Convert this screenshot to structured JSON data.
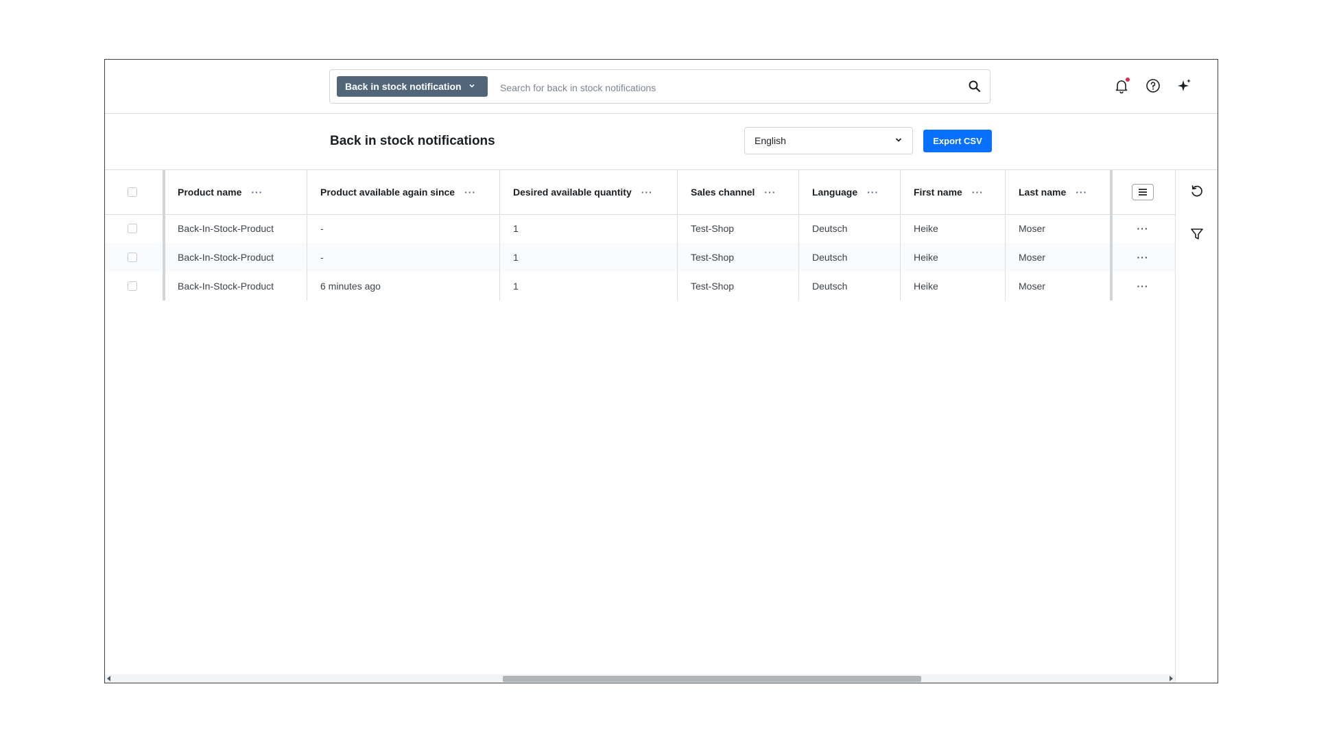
{
  "search": {
    "type_label": "Back in stock notification",
    "placeholder": "Search for back in stock notifications"
  },
  "page": {
    "title": "Back in stock notifications",
    "language_value": "English",
    "export_label": "Export CSV"
  },
  "table": {
    "columns": [
      "Product name",
      "Product available again since",
      "Desired available quantity",
      "Sales channel",
      "Language",
      "First name",
      "Last name"
    ],
    "column_menu": "···",
    "row_menu": "···",
    "rows": [
      [
        "Back-In-Stock-Product",
        "-",
        "1",
        "Test-Shop",
        "Deutsch",
        "Heike",
        "Moser"
      ],
      [
        "Back-In-Stock-Product",
        "-",
        "1",
        "Test-Shop",
        "Deutsch",
        "Heike",
        "Moser"
      ],
      [
        "Back-In-Stock-Product",
        "6 minutes ago",
        "1",
        "Test-Shop",
        "Deutsch",
        "Heike",
        "Moser"
      ]
    ]
  },
  "colors": {
    "primary": "#0870ff",
    "pill": "#52667a",
    "notification_dot": "#de294c"
  }
}
